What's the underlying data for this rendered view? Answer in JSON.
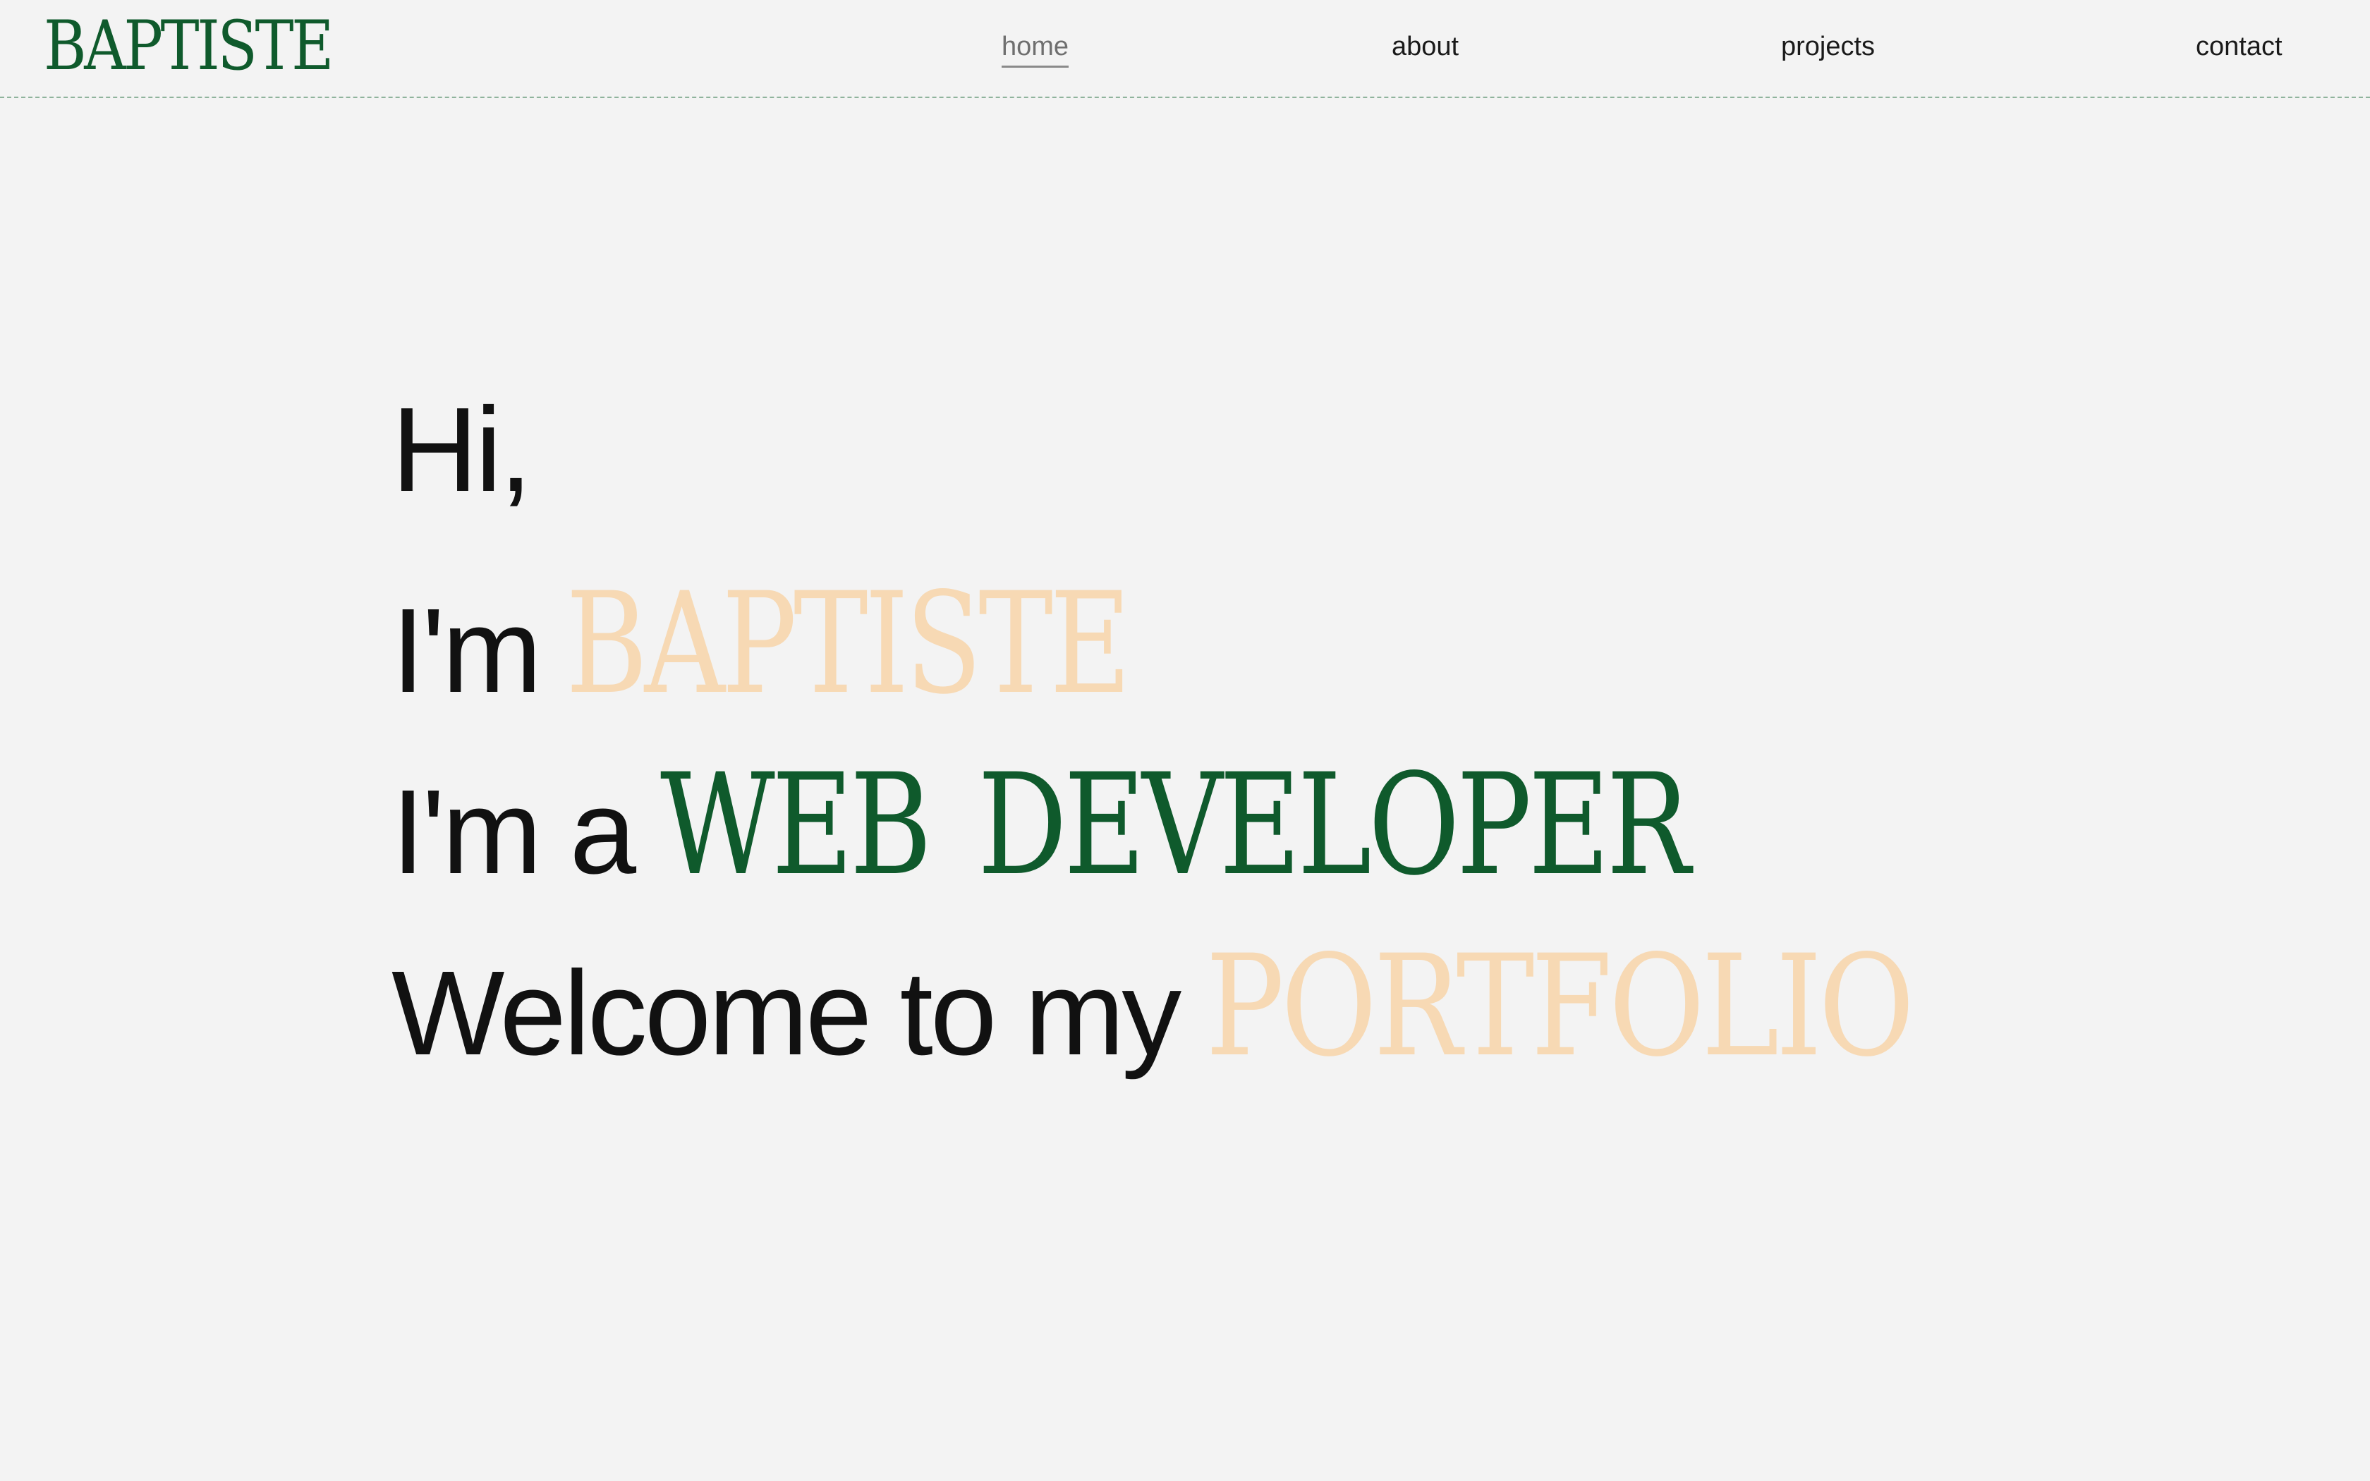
{
  "header": {
    "logo": "BAPTISTE",
    "nav": [
      {
        "label": "home",
        "active": true
      },
      {
        "label": "about",
        "active": false
      },
      {
        "label": "projects",
        "active": false
      },
      {
        "label": "contact",
        "active": false
      }
    ]
  },
  "hero": {
    "line1": "Hi,",
    "line2_prefix": "I'm",
    "line2_name": "BAPTISTE",
    "line3_prefix": "I'm a",
    "line3_role": "WEB DEVELOPER",
    "line4_prefix": "Welcome to my",
    "line4_word": "PORTFOLIO"
  },
  "colors": {
    "background": "#f3f3f3",
    "brand_green": "#0f5a2c",
    "accent_peach": "#f7d9b4",
    "text_dark": "#111111",
    "header_divider": "#8fb39c"
  }
}
